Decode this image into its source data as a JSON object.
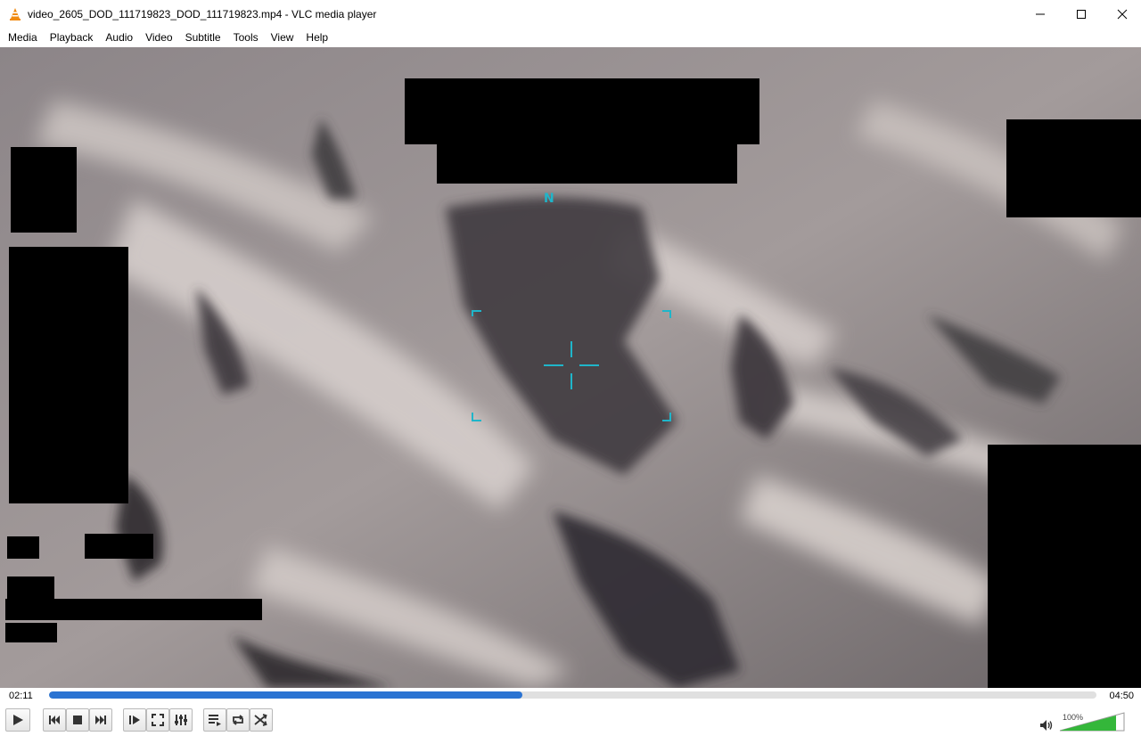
{
  "window": {
    "title": "video_2605_DOD_111719823_DOD_111719823.mp4 - VLC media player",
    "icon": "vlc-cone-icon",
    "controls": [
      "minimize-icon",
      "maximize-icon",
      "close-icon"
    ]
  },
  "menu": {
    "items": [
      "Media",
      "Playback",
      "Audio",
      "Video",
      "Subtitle",
      "Tools",
      "View",
      "Help"
    ]
  },
  "video": {
    "overlay_compass": "N",
    "hud_color": "#1fb5c9"
  },
  "playback": {
    "elapsed": "02:11",
    "total": "04:50",
    "progress_fraction": 0.4517
  },
  "controls": {
    "buttons": [
      "play-icon",
      "previous-icon",
      "stop-icon",
      "next-icon",
      "frame-step-icon",
      "fullscreen-icon",
      "extended-settings-icon",
      "playlist-icon",
      "loop-icon",
      "shuffle-icon"
    ]
  },
  "volume": {
    "label": "100%",
    "level_fraction": 1.0,
    "accent": "#34b73a"
  },
  "colors": {
    "seek_fill": "#2a73d2"
  }
}
